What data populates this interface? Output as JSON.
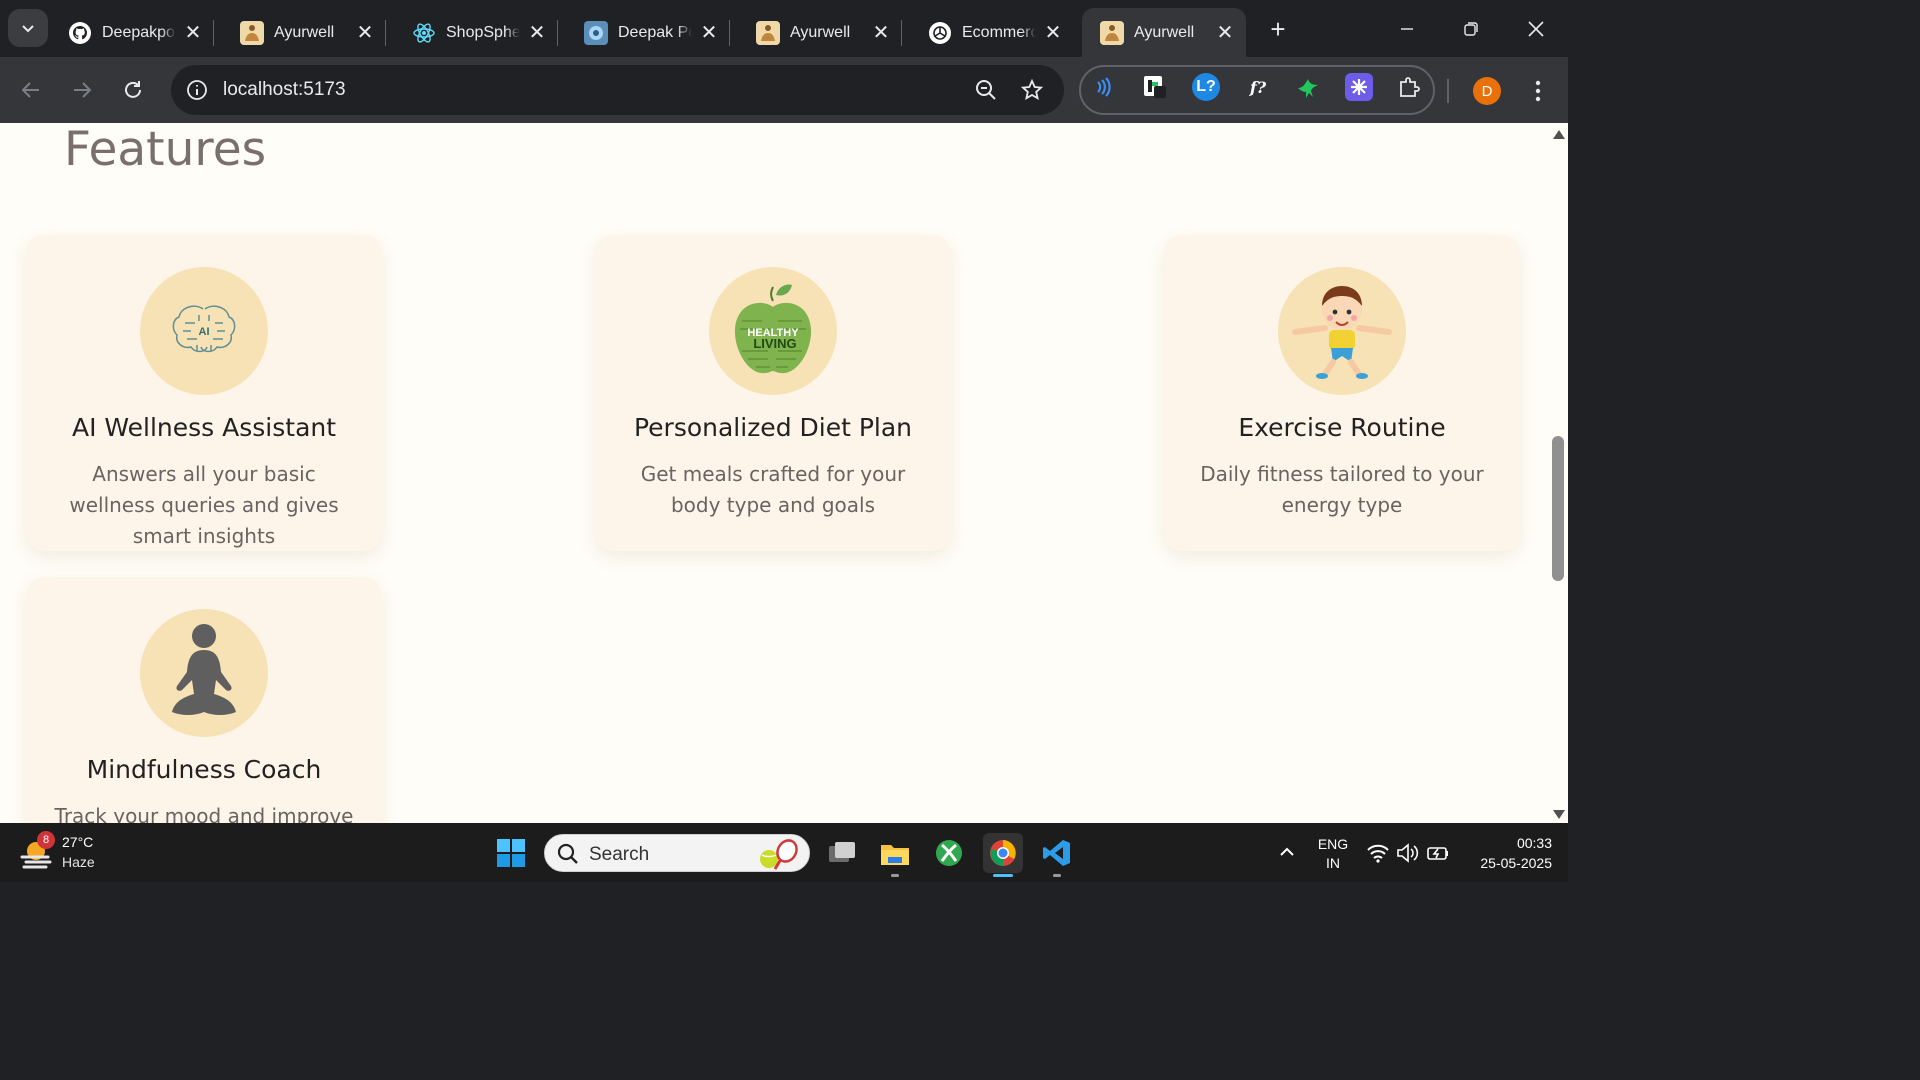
{
  "browser": {
    "tabs": [
      {
        "title": "Deepakpo",
        "favicon": "github-icon"
      },
      {
        "title": "Ayurwell",
        "favicon": "ayurwell-icon"
      },
      {
        "title": "ShopSphe",
        "favicon": "react-icon"
      },
      {
        "title": "Deepak Po",
        "favicon": "portfolio-icon"
      },
      {
        "title": "Ayurwell",
        "favicon": "ayurwell-icon"
      },
      {
        "title": "Ecommerc",
        "favicon": "openai-icon"
      },
      {
        "title": "Ayurwell",
        "favicon": "ayurwell-icon",
        "active": true
      }
    ],
    "url": "localhost:5173",
    "profile_initial": "D",
    "profile_color": "#e8710a"
  },
  "page": {
    "heading": "Features",
    "features": [
      {
        "title": "AI Wellness Assistant",
        "description": "Answers all your basic wellness queries and gives smart insights",
        "icon": "ai-brain-icon",
        "icon_text": "AI"
      },
      {
        "title": "Personalized Diet Plan",
        "description": "Get meals crafted for your body type and goals",
        "icon": "healthy-living-apple-icon",
        "icon_text_1": "HEALTHY",
        "icon_text_2": "LIVING"
      },
      {
        "title": "Exercise Routine",
        "description": "Daily fitness tailored to your energy type",
        "icon": "exercising-kid-icon"
      },
      {
        "title": "Mindfulness Coach",
        "description": "Track your mood and improve",
        "icon": "meditation-icon"
      }
    ],
    "colors": {
      "background": "#fffdf7",
      "card": "#fef5ea",
      "icon_circle": "#f6e2b4"
    }
  },
  "taskbar": {
    "weather": {
      "badge": "8",
      "temperature": "27°C",
      "condition": "Haze"
    },
    "search_label": "Search",
    "language": {
      "line1": "ENG",
      "line2": "IN"
    },
    "time": "00:33",
    "date": "25-05-2025"
  }
}
